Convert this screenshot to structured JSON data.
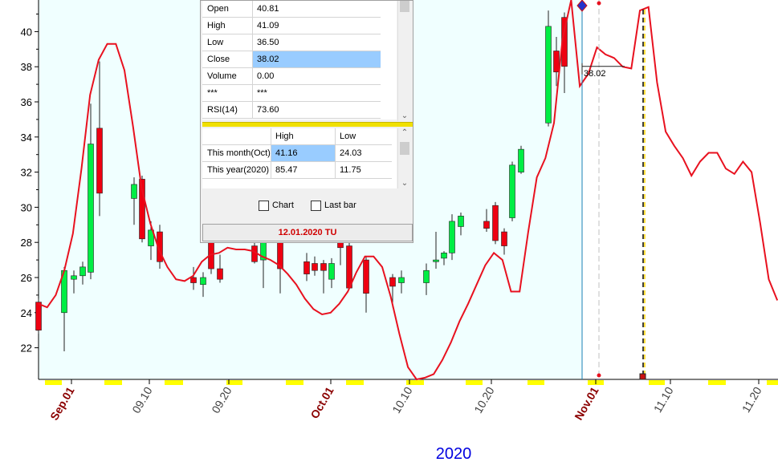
{
  "colors": {
    "background": "#ffffff",
    "plot_bg": "#f0ffff",
    "up_candle": "#00ee44",
    "down_candle": "#ee0011",
    "indicator_line": "#e8111f",
    "month_label": "#8b0000",
    "day_label": "#404040",
    "year_label": "#0000e0",
    "axis_marks": "#ffff00"
  },
  "info_panel": {
    "rows": [
      {
        "label": "Open",
        "value": "40.81"
      },
      {
        "label": "High",
        "value": "41.09"
      },
      {
        "label": "Low",
        "value": "36.50"
      },
      {
        "label": "Close",
        "value": "38.02"
      },
      {
        "label": "Volume",
        "value": "0.00"
      },
      {
        "label": "***",
        "value": "***"
      },
      {
        "label": "RSI(14)",
        "value": "73.60"
      }
    ],
    "period_table": {
      "headers": [
        "High",
        "Low"
      ],
      "rows": [
        {
          "label": "This month(Oct)",
          "high": "41.16",
          "low": "24.03"
        },
        {
          "label": "This year(2020)",
          "high": "85.47",
          "low": "11.75"
        }
      ]
    },
    "checkbox_chart": "Chart",
    "checkbox_lastbar": "Last bar",
    "date": "12.01.2020 TU"
  },
  "chart_data": {
    "type": "candlestick",
    "xlabel": "2020",
    "ylim": [
      20.2,
      41.8
    ],
    "y_ticks": [
      "22",
      "24",
      "26",
      "28",
      "30",
      "32",
      "34",
      "36",
      "38",
      "40"
    ],
    "x_tick_labels": [
      "Sep.01",
      "09.10",
      "09.20",
      "Oct.01",
      "10.10",
      "10.20",
      "Nov.01",
      "11.10",
      "11.20"
    ],
    "crosshair_value": "38.02",
    "candles": [
      {
        "o": 24.6,
        "h": 24.8,
        "l": 22.8,
        "c": 23.0
      },
      {
        "o": 24.0,
        "h": 26.6,
        "l": 21.8,
        "c": 26.4
      },
      {
        "o": 25.9,
        "h": 26.4,
        "l": 25.1,
        "c": 26.1
      },
      {
        "o": 26.1,
        "h": 26.9,
        "l": 25.6,
        "c": 26.6
      },
      {
        "o": 26.3,
        "h": 35.9,
        "l": 25.9,
        "c": 33.6
      },
      {
        "o": 34.5,
        "h": 38.3,
        "l": 29.5,
        "c": 30.8
      },
      {
        "o": 30.5,
        "h": 31.7,
        "l": 29.0,
        "c": 31.3
      },
      {
        "o": 31.6,
        "h": 31.8,
        "l": 28.0,
        "c": 28.2
      },
      {
        "o": 27.8,
        "h": 29.2,
        "l": 27.0,
        "c": 28.7
      },
      {
        "o": 28.6,
        "h": 29.0,
        "l": 26.5,
        "c": 26.9
      },
      {
        "o": 26.0,
        "h": 26.6,
        "l": 25.3,
        "c": 25.7
      },
      {
        "o": 25.6,
        "h": 26.3,
        "l": 24.9,
        "c": 26.0
      },
      {
        "o": 28.5,
        "h": 29.3,
        "l": 26.2,
        "c": 26.5
      },
      {
        "o": 26.5,
        "h": 27.3,
        "l": 25.7,
        "c": 25.9
      },
      {
        "o": 27.8,
        "h": 29.0,
        "l": 26.8,
        "c": 26.9
      },
      {
        "o": 27.0,
        "h": 28.4,
        "l": 25.4,
        "c": 28.3
      },
      {
        "o": 28.0,
        "h": 28.6,
        "l": 25.1,
        "c": 26.5
      },
      {
        "o": 26.9,
        "h": 27.4,
        "l": 25.8,
        "c": 26.2
      },
      {
        "o": 26.8,
        "h": 27.2,
        "l": 26.1,
        "c": 26.4
      },
      {
        "o": 26.8,
        "h": 27.0,
        "l": 25.1,
        "c": 26.4
      },
      {
        "o": 25.9,
        "h": 27.1,
        "l": 25.4,
        "c": 26.8
      },
      {
        "o": 28.3,
        "h": 28.6,
        "l": 26.7,
        "c": 27.7
      },
      {
        "o": 27.8,
        "h": 28.0,
        "l": 25.4,
        "c": 25.4
      },
      {
        "o": 27.0,
        "h": 27.2,
        "l": 24.0,
        "c": 25.1
      },
      {
        "o": 26.0,
        "h": 26.2,
        "l": 24.3,
        "c": 25.5
      },
      {
        "o": 25.7,
        "h": 26.4,
        "l": 25.1,
        "c": 26.0
      },
      {
        "o": 25.7,
        "h": 26.8,
        "l": 25.0,
        "c": 26.4
      },
      {
        "o": 26.9,
        "h": 28.6,
        "l": 26.5,
        "c": 27.0
      },
      {
        "o": 27.1,
        "h": 27.5,
        "l": 26.7,
        "c": 27.4
      },
      {
        "o": 27.4,
        "h": 29.6,
        "l": 27.0,
        "c": 29.2
      },
      {
        "o": 28.9,
        "h": 29.7,
        "l": 28.4,
        "c": 29.5
      },
      {
        "o": 29.2,
        "h": 29.9,
        "l": 28.6,
        "c": 28.8
      },
      {
        "o": 30.1,
        "h": 30.3,
        "l": 27.9,
        "c": 28.1
      },
      {
        "o": 28.6,
        "h": 28.8,
        "l": 27.3,
        "c": 27.8
      },
      {
        "o": 29.4,
        "h": 32.6,
        "l": 29.2,
        "c": 32.4
      },
      {
        "o": 32.0,
        "h": 33.5,
        "l": 31.9,
        "c": 33.3
      },
      {
        "o": 34.8,
        "h": 41.2,
        "l": 34.6,
        "c": 40.3
      },
      {
        "o": 38.9,
        "h": 39.7,
        "l": 36.9,
        "c": 37.7
      },
      {
        "o": 40.81,
        "h": 41.09,
        "l": 36.5,
        "c": 38.02
      }
    ],
    "rsi_line_y": [
      24.5,
      24.3,
      25.0,
      26.4,
      28.5,
      32.2,
      36.4,
      38.4,
      39.3,
      39.3,
      37.8,
      34.6,
      31.1,
      29.1,
      27.6,
      26.6,
      25.9,
      25.8,
      26.1,
      26.9,
      27.3,
      27.4,
      27.7,
      27.6,
      27.6,
      27.5,
      27.2,
      27.0,
      26.7,
      26.2,
      25.6,
      24.8,
      24.2,
      23.9,
      24.0,
      24.5,
      25.2,
      26.3,
      27.2,
      27.2,
      26.6,
      24.9,
      22.8,
      20.9,
      20.2,
      20.3,
      20.5,
      21.3,
      22.3,
      23.5,
      24.5,
      25.6,
      26.7,
      27.4,
      27.0,
      25.2,
      25.2,
      28.6,
      31.7,
      32.8,
      34.8,
      39.6,
      41.8,
      36.9,
      37.6,
      39.1,
      38.7,
      38.5,
      38.0,
      37.9,
      41.2,
      41.4,
      37.1,
      34.3,
      33.5,
      32.8,
      31.8,
      32.6,
      33.1,
      33.1,
      32.2,
      31.9,
      32.6,
      32.0,
      29.1,
      25.9,
      24.7
    ]
  }
}
